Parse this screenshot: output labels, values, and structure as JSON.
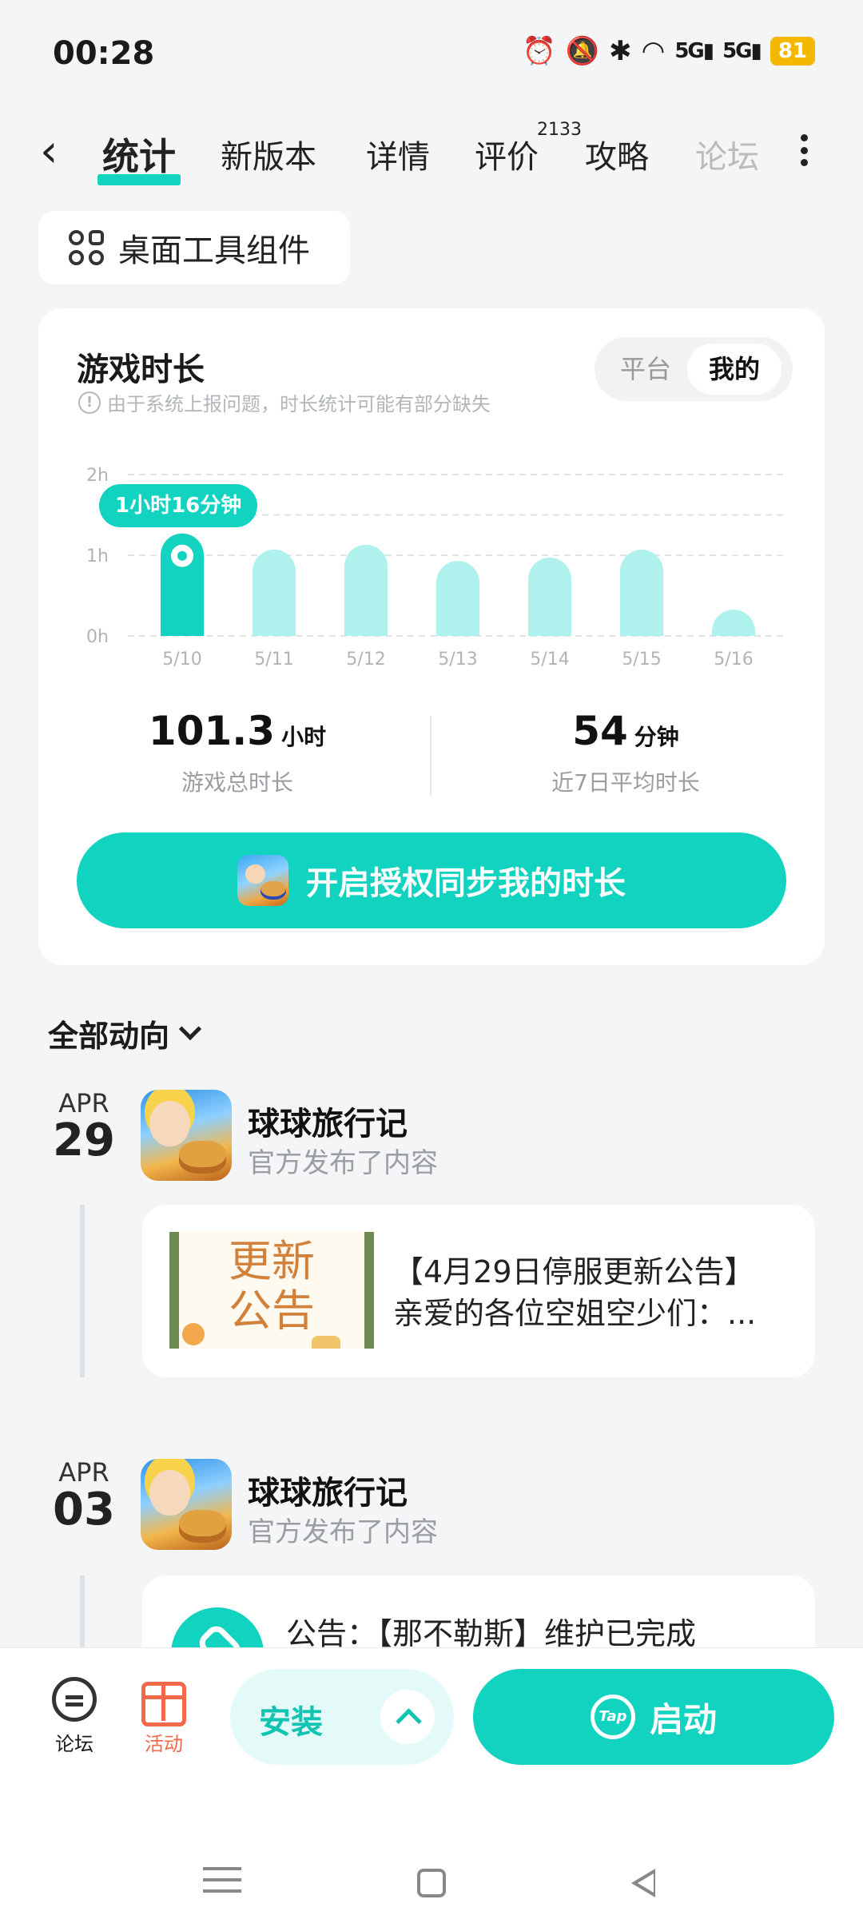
{
  "status_bar": {
    "time": "00:28",
    "signal1": "5G",
    "signal2": "5G",
    "battery": "81"
  },
  "tabs": {
    "items": [
      {
        "label": "统计",
        "active": true
      },
      {
        "label": "新版本"
      },
      {
        "label": "详情"
      },
      {
        "label": "评价"
      },
      {
        "label": "攻略"
      },
      {
        "label": "论坛"
      }
    ],
    "review_count": "2133"
  },
  "widget_button": {
    "label": "桌面工具组件"
  },
  "play_time_card": {
    "title": "游戏时长",
    "note": "由于系统上报问题，时长统计可能有部分缺失",
    "toggle": {
      "option_platform": "平台",
      "option_mine": "我的",
      "selected": "我的"
    },
    "tooltip": "1小时16分钟",
    "total": {
      "value": "101.3",
      "unit": "小时",
      "label": "游戏总时长"
    },
    "average": {
      "value": "54",
      "unit": "分钟",
      "label": "近7日平均时长"
    },
    "auth_button": "开启授权同步我的时长",
    "accent_color": "#11d3c0",
    "bar_color": "#aff1ec"
  },
  "chart_data": {
    "type": "bar",
    "categories": [
      "5/10",
      "5/11",
      "5/12",
      "5/13",
      "5/14",
      "5/15",
      "5/16"
    ],
    "values": [
      1.27,
      1.07,
      1.13,
      0.93,
      0.97,
      1.07,
      0.1
    ],
    "value_unit": "h",
    "y_ticks": [
      "0h",
      "1h",
      "2h"
    ],
    "ylim": [
      0,
      2
    ],
    "highlighted_index": 0,
    "grid": true
  },
  "feed": {
    "header": "全部动向",
    "entries": [
      {
        "month": "APR",
        "day": "29",
        "game": "球球旅行记",
        "subtitle": "官方发布了内容",
        "image_text_line1": "更新",
        "image_text_line2": "公告",
        "text_line1": "【4月29日停服更新公告】",
        "text_line2": "亲爱的各位空姐空少们：..."
      },
      {
        "month": "APR",
        "day": "03",
        "game": "球球旅行记",
        "subtitle": "官方发布了内容",
        "text_line1": "公告：【那不勒斯】维护已完成"
      }
    ]
  },
  "bottom_bar": {
    "forum": "论坛",
    "activity": "活动",
    "install": "安装",
    "launch": "启动",
    "tap_logo": "Tap"
  }
}
